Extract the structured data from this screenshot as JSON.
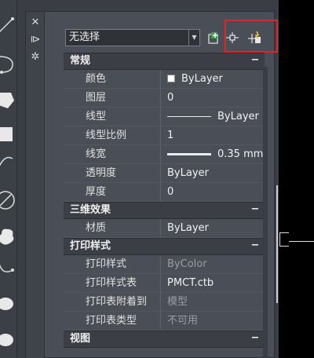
{
  "toolbar": {
    "icons": [
      "line-icon",
      "polyline-icon",
      "arc-icon",
      "polygon-icon",
      "rectangle-icon",
      "spline-icon",
      "circle-icon",
      "cloud-icon",
      "spline-curve-icon",
      "ellipse-icon",
      "ellipse-arc-icon",
      "point-icon"
    ]
  },
  "palette": {
    "strip": {
      "close_glyph": "✕",
      "autohide_glyph": "⧐",
      "settings_glyph": "✲"
    },
    "selection": {
      "value": "无选择",
      "arrow": "▼"
    },
    "buttons": [
      "toggle-pickadd-icon",
      "select-objects-icon",
      "quick-select-icon"
    ],
    "sections": [
      {
        "title": "常规",
        "toggle": "−",
        "rows": [
          {
            "label": "颜色",
            "value": "ByLayer",
            "kind": "color"
          },
          {
            "label": "图层",
            "value": "0"
          },
          {
            "label": "线型",
            "value": "ByLayer",
            "kind": "linetype"
          },
          {
            "label": "线型比例",
            "value": "1"
          },
          {
            "label": "线宽",
            "value": "0.35 mm",
            "kind": "lineweight"
          },
          {
            "label": "透明度",
            "value": "ByLayer"
          },
          {
            "label": "厚度",
            "value": "0"
          }
        ]
      },
      {
        "title": "三维效果",
        "toggle": "−",
        "rows": [
          {
            "label": "材质",
            "value": "ByLayer"
          }
        ]
      },
      {
        "title": "打印样式",
        "toggle": "−",
        "rows": [
          {
            "label": "打印样式",
            "value": "ByColor",
            "dim": true
          },
          {
            "label": "打印样式表",
            "value": "PMCT.ctb"
          },
          {
            "label": "打印表附着到",
            "value": "模型",
            "dim": true
          },
          {
            "label": "打印表类型",
            "value": "不可用",
            "dim": true
          }
        ]
      },
      {
        "title": "视图",
        "toggle": "−",
        "rows": []
      }
    ]
  },
  "colors": {
    "highlight": "#e0242a",
    "panel": "#4a4e56",
    "section": "#3b3e44"
  }
}
